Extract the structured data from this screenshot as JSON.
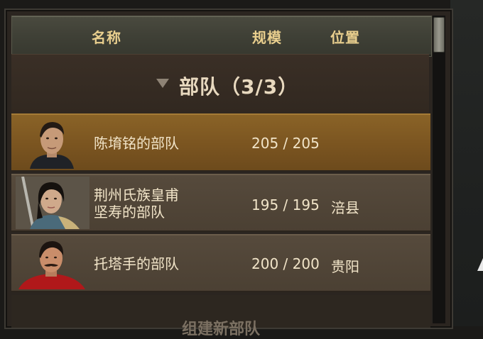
{
  "table": {
    "columns": {
      "name": "名称",
      "size": "规模",
      "location": "位置"
    }
  },
  "group": {
    "title": "部队（3/3）"
  },
  "parties": [
    {
      "name": "陈堉铭的部队",
      "size": "205 / 205",
      "location": "",
      "portrait": "portrait-dark-hair-man-icon"
    },
    {
      "name": "荆州氏族皇甫\n坚寿的部队",
      "size": "195 / 195",
      "location": "涪县",
      "portrait": "portrait-woman-with-sword-icon"
    },
    {
      "name": "托塔手的部队",
      "size": "200 / 200",
      "location": "贵阳",
      "portrait": "portrait-mustache-man-red-cloak-icon"
    }
  ],
  "footer": {
    "create_label": "组建新部队"
  },
  "colors": {
    "gold_text": "#e9cf8e",
    "selected_row": "#7a5420",
    "row": "#4b4033"
  }
}
